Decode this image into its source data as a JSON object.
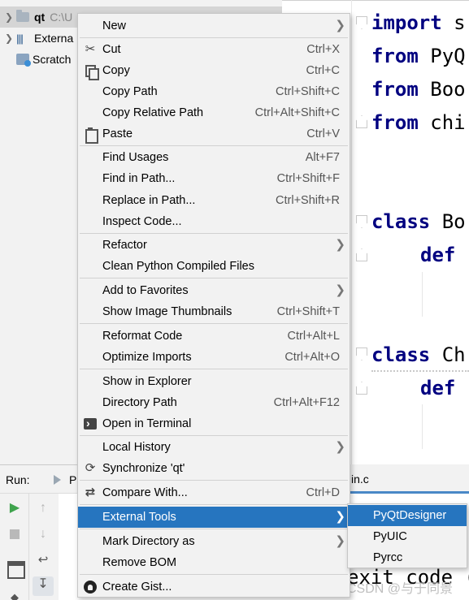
{
  "project_tree": {
    "root_name": "qt",
    "root_path": "C:\\U",
    "external_libraries": "Externa",
    "scratches": "Scratch"
  },
  "editor": {
    "lines": [
      {
        "keyword": "import",
        "rest": " s"
      },
      {
        "keyword": "from",
        "rest": " PyQ"
      },
      {
        "keyword": "from",
        "rest": " Boo"
      },
      {
        "keyword": "from",
        "rest": " chi"
      },
      {
        "keyword": "class",
        "rest": " Bo"
      },
      {
        "keyword": "def",
        "rest": ""
      },
      {
        "keyword": "class",
        "rest": " Ch"
      },
      {
        "keyword": "def",
        "rest": ""
      }
    ]
  },
  "run_panel": {
    "label": "Run:",
    "tab_text": "P",
    "editor_tab": "in.c",
    "console_text": "exit code ("
  },
  "watermark": "CSDN @与于同景",
  "context_menu": {
    "items": [
      {
        "label": "New",
        "shortcut": "",
        "submenu": true,
        "icon": ""
      },
      {
        "label": "Cut",
        "shortcut": "Ctrl+X",
        "submenu": false,
        "icon": "scissors-icon"
      },
      {
        "label": "Copy",
        "shortcut": "Ctrl+C",
        "submenu": false,
        "icon": "copy-icon"
      },
      {
        "label": "Copy Path",
        "shortcut": "Ctrl+Shift+C",
        "submenu": false,
        "icon": ""
      },
      {
        "label": "Copy Relative Path",
        "shortcut": "Ctrl+Alt+Shift+C",
        "submenu": false,
        "icon": ""
      },
      {
        "label": "Paste",
        "shortcut": "Ctrl+V",
        "submenu": false,
        "icon": "paste-icon"
      },
      {
        "label": "Find Usages",
        "shortcut": "Alt+F7",
        "submenu": false,
        "icon": ""
      },
      {
        "label": "Find in Path...",
        "shortcut": "Ctrl+Shift+F",
        "submenu": false,
        "icon": ""
      },
      {
        "label": "Replace in Path...",
        "shortcut": "Ctrl+Shift+R",
        "submenu": false,
        "icon": ""
      },
      {
        "label": "Inspect Code...",
        "shortcut": "",
        "submenu": false,
        "icon": ""
      },
      {
        "label": "Refactor",
        "shortcut": "",
        "submenu": true,
        "icon": ""
      },
      {
        "label": "Clean Python Compiled Files",
        "shortcut": "",
        "submenu": false,
        "icon": ""
      },
      {
        "label": "Add to Favorites",
        "shortcut": "",
        "submenu": true,
        "icon": ""
      },
      {
        "label": "Show Image Thumbnails",
        "shortcut": "Ctrl+Shift+T",
        "submenu": false,
        "icon": ""
      },
      {
        "label": "Reformat Code",
        "shortcut": "Ctrl+Alt+L",
        "submenu": false,
        "icon": ""
      },
      {
        "label": "Optimize Imports",
        "shortcut": "Ctrl+Alt+O",
        "submenu": false,
        "icon": ""
      },
      {
        "label": "Show in Explorer",
        "shortcut": "",
        "submenu": false,
        "icon": ""
      },
      {
        "label": "Directory Path",
        "shortcut": "Ctrl+Alt+F12",
        "submenu": false,
        "icon": ""
      },
      {
        "label": "Open in Terminal",
        "shortcut": "",
        "submenu": false,
        "icon": "terminal-icon"
      },
      {
        "label": "Local History",
        "shortcut": "",
        "submenu": true,
        "icon": ""
      },
      {
        "label": "Synchronize 'qt'",
        "shortcut": "",
        "submenu": false,
        "icon": "sync-icon"
      },
      {
        "label": "Compare With...",
        "shortcut": "Ctrl+D",
        "submenu": false,
        "icon": "compare-icon"
      },
      {
        "label": "External Tools",
        "shortcut": "",
        "submenu": true,
        "icon": "",
        "highlighted": true
      },
      {
        "label": "Mark Directory as",
        "shortcut": "",
        "submenu": true,
        "icon": ""
      },
      {
        "label": "Remove BOM",
        "shortcut": "",
        "submenu": false,
        "icon": ""
      },
      {
        "label": "Create Gist...",
        "shortcut": "",
        "submenu": false,
        "icon": "github-icon"
      }
    ]
  },
  "external_tools_submenu": {
    "items": [
      {
        "label": "PyQtDesigner",
        "highlighted": true
      },
      {
        "label": "PyUIC",
        "highlighted": false
      },
      {
        "label": "Pyrcc",
        "highlighted": false
      }
    ]
  },
  "colors": {
    "highlight": "#2675bf",
    "keyword": "#000080",
    "menu_bg": "#f2f2f2"
  }
}
